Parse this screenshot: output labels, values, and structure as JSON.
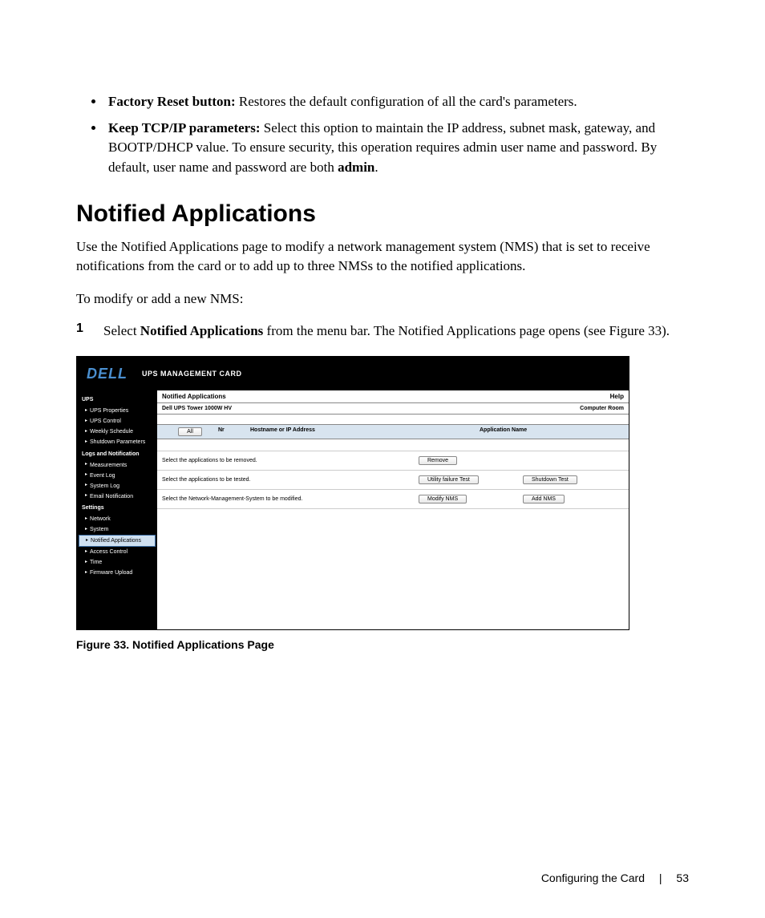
{
  "intro_bullets": [
    {
      "label": "Factory Reset button:",
      "text": " Restores the default configuration of all the card's parameters."
    },
    {
      "label": "Keep TCP/IP parameters:",
      "text": " Select this option to maintain the IP address, subnet mask, gateway, and BOOTP/DHCP value. To ensure security, this operation requires admin user name and password. By default, user name and password are both ",
      "tail_bold": "admin",
      "tail_after": "."
    }
  ],
  "section_heading": "Notified Applications",
  "para1": "Use the Notified Applications page to modify a network management system (NMS) that is set to receive notifications from the card or to add up to three NMSs to the notified applications.",
  "para2": "To modify or add a new NMS:",
  "step": {
    "num": "1",
    "pre": "Select ",
    "bold": "Notified Applications",
    "post": " from the menu bar. The Notified Applications page opens (see Figure 33)."
  },
  "figure": {
    "logo": "DELL",
    "card_title": "UPS MANAGEMENT CARD",
    "sidebar": {
      "groups": [
        {
          "head": "UPS",
          "items": [
            "UPS Properties",
            "UPS Control",
            "Weekly Schedule",
            "Shutdown Parameters"
          ]
        },
        {
          "head": "Logs and Notification",
          "items": [
            "Measurements",
            "Event Log",
            "System Log",
            "Email Notification"
          ]
        },
        {
          "head": "Settings",
          "items": [
            "Network",
            "System",
            "Notified Applications",
            "Access Control",
            "Time",
            "Firmware Upload"
          ],
          "selected_index": 2
        }
      ]
    },
    "content": {
      "title": "Notified Applications",
      "help": "Help",
      "device": "Dell UPS Tower 1000W HV",
      "location": "Computer Room",
      "table_head": {
        "all_btn": "All",
        "nr": "Nr",
        "host": "Hostname or IP Address",
        "app": "Application Name"
      },
      "rows": [
        {
          "label": "Select the applications to be removed.",
          "btn1": "Remove",
          "btn2": ""
        },
        {
          "label": "Select the applications to be tested.",
          "btn1": "Utility failure Test",
          "btn2": "Shutdown Test"
        },
        {
          "label": "Select the Network-Management-System to be modified.",
          "btn1": "Modify NMS",
          "btn2": "Add NMS"
        }
      ]
    }
  },
  "caption": "Figure 33. Notified Applications Page",
  "footer": {
    "chapter": "Configuring the Card",
    "page": "53"
  }
}
